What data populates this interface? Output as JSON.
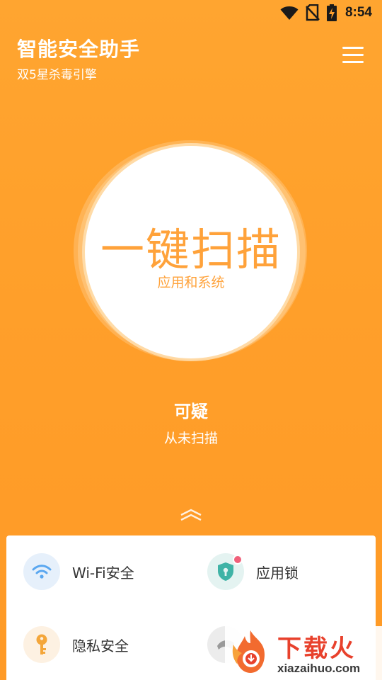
{
  "status_bar": {
    "time": "8:54",
    "icons": [
      "wifi-icon",
      "no-sim-icon",
      "battery-charging-icon"
    ]
  },
  "header": {
    "title": "智能安全助手",
    "subtitle": "双5星杀毒引擎",
    "menu_icon": "hamburger-menu-icon"
  },
  "scan": {
    "title": "一键扫描",
    "subtitle": "应用和系统"
  },
  "status": {
    "label": "可疑",
    "detail": "从未扫描"
  },
  "expand_icon": "double-chevron-up-icon",
  "features": [
    {
      "label": "Wi-Fi安全",
      "icon": "wifi-icon",
      "icon_bg": "#e6f0fb",
      "icon_color": "#5aa7f0"
    },
    {
      "label": "应用锁",
      "icon": "shield-lock-icon",
      "icon_bg": "#e4f3f1",
      "icon_color": "#3fb3a6",
      "badge": true
    },
    {
      "label": "隐私安全",
      "icon": "key-icon",
      "icon_bg": "#fdf1e2",
      "icon_color": "#f4a63a"
    },
    {
      "label": "",
      "icon": "cleanup-icon",
      "icon_bg": "#ececec",
      "icon_color": "#9a9a9a"
    }
  ],
  "watermark": {
    "name": "下载火",
    "url": "xiazaihuo.com"
  },
  "colors": {
    "background": "#ffa02c",
    "accent": "#ffa23a",
    "badge": "#f0607a",
    "watermark_red": "#e8412c"
  }
}
